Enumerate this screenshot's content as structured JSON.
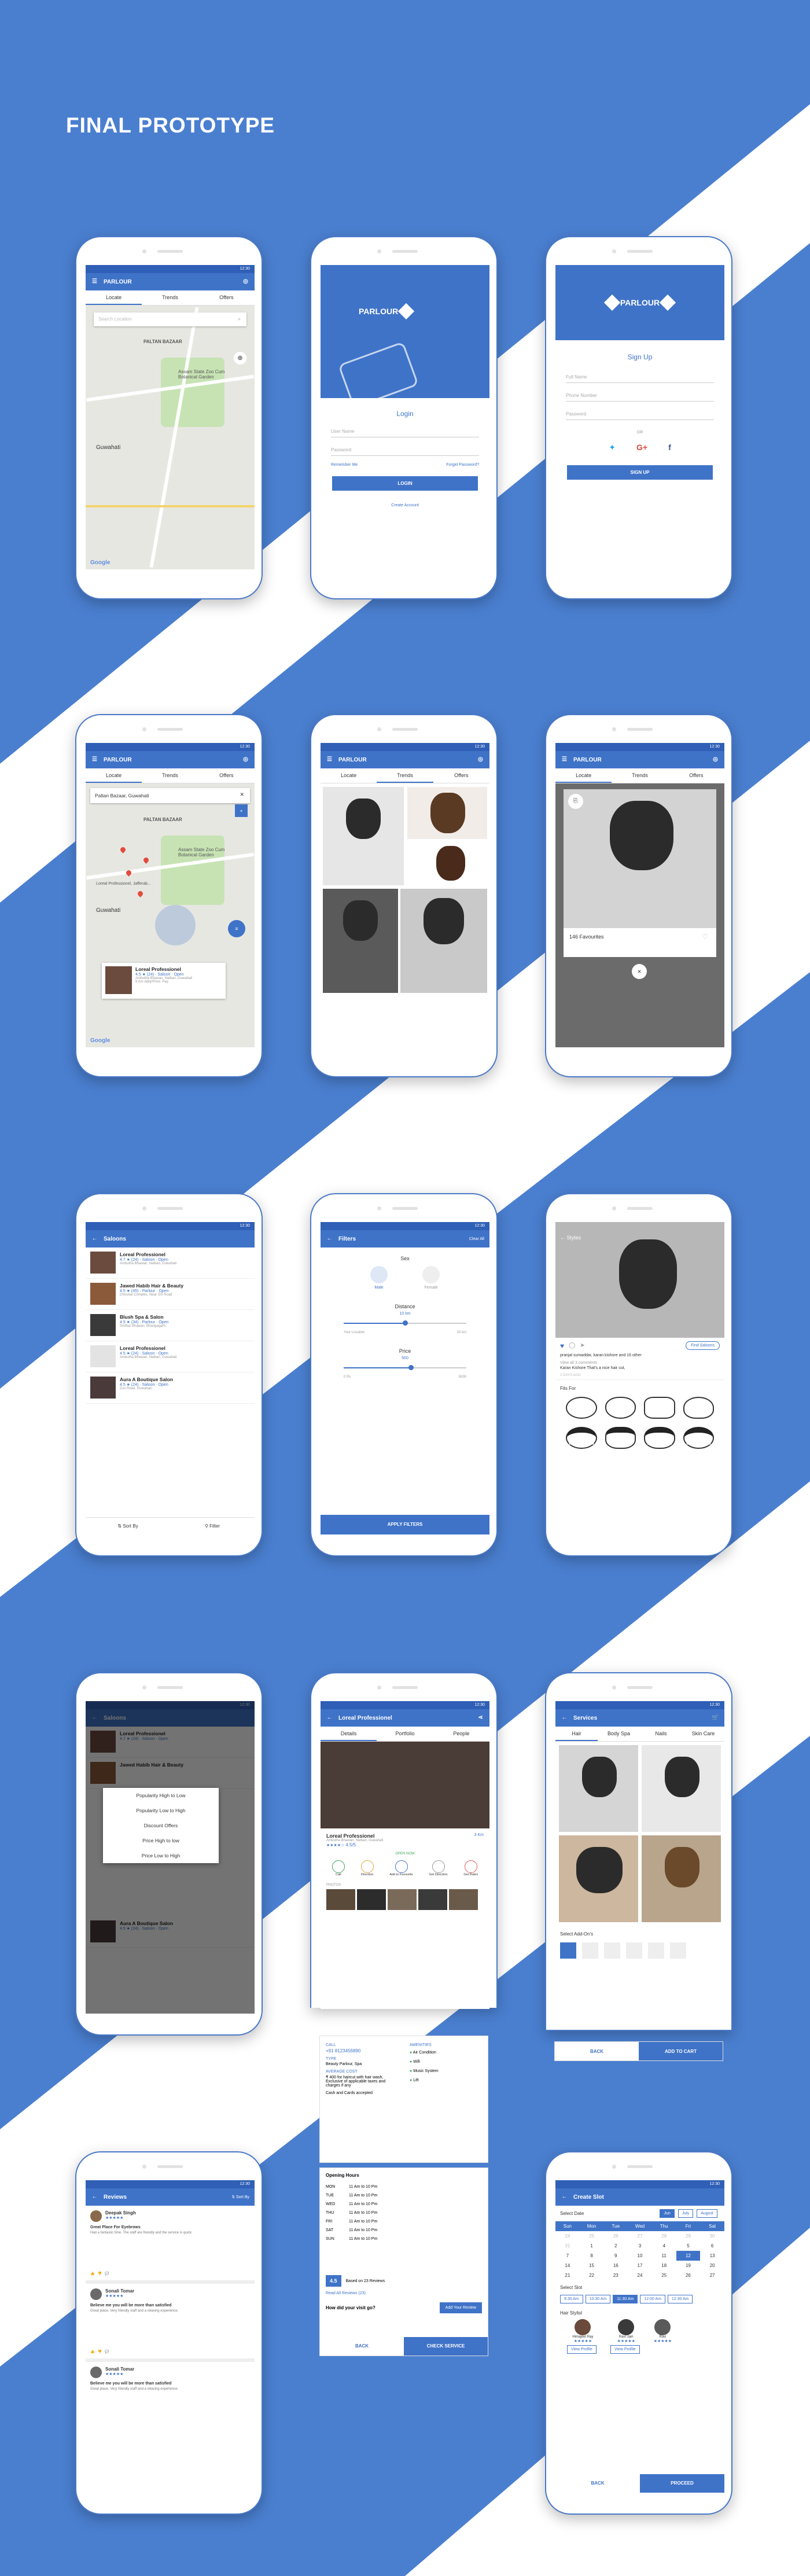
{
  "page": {
    "title": "FINAL PROTOTYPE"
  },
  "colors": {
    "primary": "#3f73c8",
    "background_stripe": "#4a7fd0",
    "white": "#ffffff"
  },
  "status_time": "12:30",
  "app": {
    "name": "PARLOUR",
    "logo_text": "PARLOUR"
  },
  "tabs": {
    "locate": "Locate",
    "trends": "Trends",
    "offers": "Offers"
  },
  "map": {
    "search_placeholder": "Search Location",
    "area_1": "PALTAN BAZAAR",
    "area_2": "Assam State Zoo Cum Botanical Garden",
    "city": "Guwahati",
    "google": "Google",
    "search_value": "Paltan Bazaar, Guwahati",
    "pin_label": "Loreal Professionel, Jafferab..."
  },
  "map_card": {
    "name": "Loreal Professionel",
    "rating": "4.5 ★ (24) · Saloon · Open",
    "address": "Ambutha Bhawan, Nalbari, Guwahati",
    "timing": "8 Am daily/Price: Pay"
  },
  "login": {
    "heading": "Login",
    "username": "User Name",
    "password": "Password",
    "remember": "Remember Me",
    "forgot": "Forget Password?",
    "button": "LOGIN",
    "create": "Create Account"
  },
  "signup": {
    "heading": "Sign Up",
    "fullname": "Full Name",
    "phone": "Phone Number",
    "password": "Password",
    "or": "OR",
    "button": "SIGN UP"
  },
  "trends": {
    "favourites": "146 Favourites"
  },
  "saloons": {
    "title": "Saloons",
    "items": [
      {
        "name": "Loreal Professionel",
        "meta": "4.7 ★ (24) · Saloon · Open",
        "addr": "Ambutha Bhawan, Nalbari, Guwahati"
      },
      {
        "name": "Jawed Habib Hair & Beauty",
        "meta": "4.5 ★ (45) · Parlour · Open",
        "addr": "Dhirubai Complex, Near GS Road"
      },
      {
        "name": "Blush Spa & Salon",
        "meta": "4.5 ★ (34) · Parlour · Open",
        "addr": "Sridhar Bhawan, Bhangagarh"
      },
      {
        "name": "Loreal Professionel",
        "meta": "4.5 ★ (24) · Saloon · Open",
        "addr": "Ambutha Bhawan, Nalbari, Guwahati"
      },
      {
        "name": "Aura A Boutique Salon",
        "meta": "4.5 ★ (24) · Saloon · Open",
        "addr": "Zoo Road, Guwahati"
      }
    ],
    "sort": "Sort By",
    "filter": "Filter"
  },
  "filters": {
    "title": "Filters",
    "clear": "Clear All",
    "sex": "Sex",
    "male": "Male",
    "female": "Female",
    "distance": "Distance",
    "dist_val": "10 km",
    "dist_min": "Your Location",
    "dist_max": "15 km",
    "price": "Price",
    "price_val": "500",
    "price_min": "0 Rs",
    "price_max": "5000",
    "apply": "APPLY FILTERS"
  },
  "styles": {
    "title": "Styles",
    "find": "Find Saloons",
    "credit": "pranjal sumaddar, karan kishore and 16 other",
    "comment_head": "View all 3 comments",
    "comment": "Karan Kishore That's a nice hair cut,",
    "time": "2 DAYS AGO",
    "fits": "Fits For"
  },
  "sort_menu": {
    "items": [
      "Popularity High to Low",
      "Popularity Low to High",
      "Discount Offers",
      "Price High to low",
      "Price Low to High"
    ]
  },
  "detail": {
    "title": "Loreal Professionel",
    "tabs": [
      "Details",
      "Portfolio",
      "People"
    ],
    "name": "Loreal Professionel",
    "addr": "Ambutha Bhawan, Nalbari, Guwahati",
    "rating": "4.5/5",
    "dist": "3 Km",
    "open": "OPEN NOW",
    "actions": [
      "Call",
      "Direction",
      "Add to Favourite",
      "Get Direction",
      "Get Rates"
    ],
    "photos": "PHOTOS",
    "call_label": "CALL",
    "phone": "+91 8123456890",
    "type_label": "TYPE",
    "type": "Beauty Parlour, Spa",
    "avg_label": "AVERAGE COST",
    "avg": "₹ 400 for haircut with hair wash, Exclusive of applicable taxes and charges if any",
    "pay": "Cash and Cards accepted",
    "amen_label": "AMENITIES",
    "amen": [
      "Air Condition",
      "Wifi",
      "Music System",
      "Lift"
    ],
    "hours_label": "Opening Hours",
    "hours": [
      [
        "MON",
        "11 Am to 10 Pm"
      ],
      [
        "TUE",
        "11 Am to 10 Pm"
      ],
      [
        "WED",
        "11 Am to 10 Pm"
      ],
      [
        "THU",
        "11 Am to 10 Pm"
      ],
      [
        "FRI",
        "11 Am to 10 Pm"
      ],
      [
        "SAT",
        "11 Am to 10 Pm"
      ],
      [
        "SUN",
        "11 Am to 10 Pm"
      ]
    ],
    "score": "4.5",
    "reviews": "Based on 23 Reviews",
    "read": "Read All Reviews (23)",
    "ask": "How did your visit go?",
    "add_review": "Add Your Review",
    "back": "BACK",
    "check": "CHECK SERVICE"
  },
  "services": {
    "title": "Services",
    "cats": [
      "Hair",
      "Body Spa",
      "Nails",
      "Skin Care"
    ],
    "addons": "Select Add-On's",
    "back": "BACK",
    "cart": "ADD TO CART"
  },
  "reviews": {
    "title": "Reviews",
    "sort": "Sort By",
    "items": [
      {
        "name": "Deepak Singh",
        "head": "Great Place For Eyebrows",
        "body": "Had a fantastic time. The staff are friendly and the service is quick."
      },
      {
        "name": "Sonali Tomar",
        "head": "Believe me you will be more than satisfied",
        "body": "Great place. Very friendly staff and a relaxing experience."
      },
      {
        "name": "Sonali Tomar",
        "head": "Believe me you will be more than satisfied",
        "body": "Great place. Very friendly staff and a relaxing experience."
      }
    ]
  },
  "slot": {
    "title": "Create Slot",
    "date": "Select Date",
    "months": [
      "Jun",
      "July",
      "August",
      "Sept"
    ],
    "days": [
      "Sun",
      "Mon",
      "Tue",
      "Wed",
      "Thu",
      "Fri",
      "Sat"
    ],
    "dates": [
      "24",
      "25",
      "26",
      "27",
      "28",
      "29",
      "30",
      "31",
      "1",
      "2",
      "3",
      "4",
      "5",
      "6",
      "7",
      "8",
      "9",
      "10",
      "11",
      "12",
      "13",
      "14",
      "15",
      "16",
      "17",
      "18",
      "19",
      "20",
      "21",
      "22",
      "23",
      "24",
      "25",
      "26",
      "27"
    ],
    "slot_label": "Select Slot",
    "times": [
      "9:30 Am",
      "10:30 Am",
      "11:30 Am",
      "12:00 Am",
      "12:30 Am"
    ],
    "stylist": "Hair Stylist",
    "stylists": [
      "Himajeet Ray",
      "Ravi Jain",
      "Ravi"
    ],
    "view": "View Profile",
    "back": "BACK",
    "proceed": "PROCEED"
  }
}
